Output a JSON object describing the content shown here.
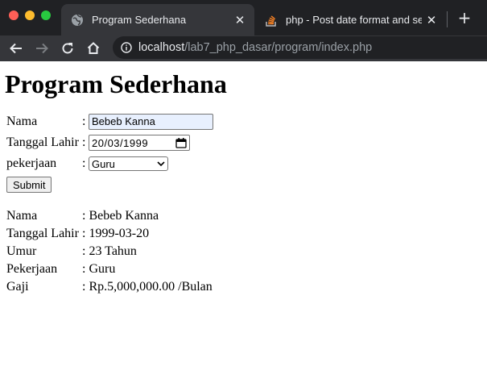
{
  "browser": {
    "tabs": [
      {
        "title": "Program Sederhana",
        "active": true,
        "icon": "globe-icon"
      },
      {
        "title": "php - Post date format and sele",
        "active": false,
        "icon": "stackoverflow-icon"
      }
    ],
    "close_glyph": "✕",
    "new_tab_glyph": "+",
    "address": {
      "host": "localhost",
      "path": "/lab7_php_dasar/program/index.php"
    },
    "colors": {
      "chrome_dark": "#202124",
      "chrome_toolbar": "#35363a",
      "text": "#e8eaed"
    }
  },
  "page": {
    "title": "Program Sederhana",
    "form": {
      "nama_label": "Nama",
      "nama_value": "Bebeb Kanna",
      "tanggal_label": "Tanggal Lahir",
      "tanggal_value": "20/03/1999",
      "pekerjaan_label": "pekerjaan",
      "pekerjaan_value": "Guru",
      "colon": ":",
      "submit_label": "Submit"
    },
    "result": [
      {
        "label": "Nama",
        "value": ": Bebeb Kanna"
      },
      {
        "label": "Tanggal Lahir",
        "value": ": 1999-03-20"
      },
      {
        "label": "Umur",
        "value": ": 23 Tahun"
      },
      {
        "label": "Pekerjaan",
        "value": ": Guru"
      },
      {
        "label": "Gaji",
        "value": ": Rp.5,000,000.00 /Bulan"
      }
    ]
  }
}
